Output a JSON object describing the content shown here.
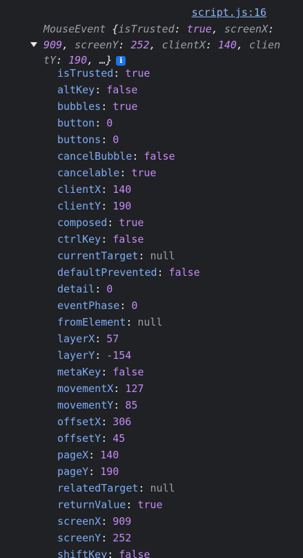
{
  "source_link": "script.js:16",
  "summary": {
    "class_name": "MouseEvent",
    "open_brace": "{",
    "preview": [
      {
        "key": "isTrusted",
        "value": "true"
      },
      {
        "key": "screenX",
        "value": "909"
      },
      {
        "key": "screenY",
        "value": "252"
      },
      {
        "key": "clientX",
        "value": "140"
      },
      {
        "key": "clientY",
        "value": "190"
      }
    ],
    "ellipsis": "…}",
    "info_icon": "i"
  },
  "properties": [
    {
      "key": "isTrusted",
      "value": "true",
      "type": "boolean"
    },
    {
      "key": "altKey",
      "value": "false",
      "type": "boolean"
    },
    {
      "key": "bubbles",
      "value": "true",
      "type": "boolean"
    },
    {
      "key": "button",
      "value": "0",
      "type": "number"
    },
    {
      "key": "buttons",
      "value": "0",
      "type": "number"
    },
    {
      "key": "cancelBubble",
      "value": "false",
      "type": "boolean"
    },
    {
      "key": "cancelable",
      "value": "true",
      "type": "boolean"
    },
    {
      "key": "clientX",
      "value": "140",
      "type": "number"
    },
    {
      "key": "clientY",
      "value": "190",
      "type": "number"
    },
    {
      "key": "composed",
      "value": "true",
      "type": "boolean"
    },
    {
      "key": "ctrlKey",
      "value": "false",
      "type": "boolean"
    },
    {
      "key": "currentTarget",
      "value": "null",
      "type": "null"
    },
    {
      "key": "defaultPrevented",
      "value": "false",
      "type": "boolean"
    },
    {
      "key": "detail",
      "value": "0",
      "type": "number"
    },
    {
      "key": "eventPhase",
      "value": "0",
      "type": "number"
    },
    {
      "key": "fromElement",
      "value": "null",
      "type": "null"
    },
    {
      "key": "layerX",
      "value": "57",
      "type": "number"
    },
    {
      "key": "layerY",
      "value": "-154",
      "type": "number"
    },
    {
      "key": "metaKey",
      "value": "false",
      "type": "boolean"
    },
    {
      "key": "movementX",
      "value": "127",
      "type": "number"
    },
    {
      "key": "movementY",
      "value": "85",
      "type": "number"
    },
    {
      "key": "offsetX",
      "value": "306",
      "type": "number"
    },
    {
      "key": "offsetY",
      "value": "45",
      "type": "number"
    },
    {
      "key": "pageX",
      "value": "140",
      "type": "number"
    },
    {
      "key": "pageY",
      "value": "190",
      "type": "number"
    },
    {
      "key": "relatedTarget",
      "value": "null",
      "type": "null"
    },
    {
      "key": "returnValue",
      "value": "true",
      "type": "boolean"
    },
    {
      "key": "screenX",
      "value": "909",
      "type": "number"
    },
    {
      "key": "screenY",
      "value": "252",
      "type": "number"
    },
    {
      "key": "shiftKey",
      "value": "false",
      "type": "boolean"
    }
  ]
}
